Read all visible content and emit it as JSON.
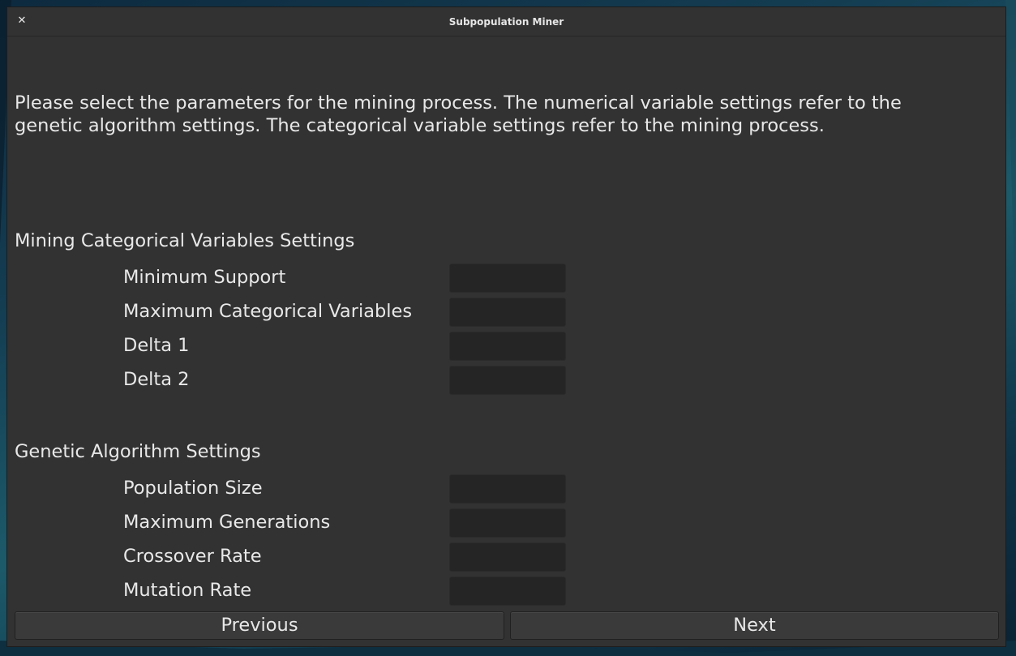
{
  "window": {
    "title": "Subpopulation Miner",
    "close_icon": "close-icon"
  },
  "intro": {
    "line1": "Please select the parameters for the mining process. The numerical variable settings refer to the",
    "line2": "genetic algorithm settings. The categorical variable settings refer to the mining process."
  },
  "categorical": {
    "title": "Mining Categorical Variables Settings",
    "fields": [
      {
        "label": "Minimum Support",
        "value": ""
      },
      {
        "label": "Maximum Categorical Variables",
        "value": ""
      },
      {
        "label": "Delta 1",
        "value": ""
      },
      {
        "label": "Delta 2",
        "value": ""
      }
    ]
  },
  "genetic": {
    "title": "Genetic Algorithm Settings",
    "fields": [
      {
        "label": "Population Size",
        "value": ""
      },
      {
        "label": "Maximum Generations",
        "value": ""
      },
      {
        "label": "Crossover Rate",
        "value": ""
      },
      {
        "label": "Mutation Rate",
        "value": ""
      }
    ]
  },
  "navigation": {
    "previous_label": "Previous",
    "next_label": "Next"
  },
  "colors": {
    "window_bg": "#323232",
    "input_bg": "#252525",
    "button_bg": "#3a3a3a",
    "text": "#e8e8e8"
  }
}
